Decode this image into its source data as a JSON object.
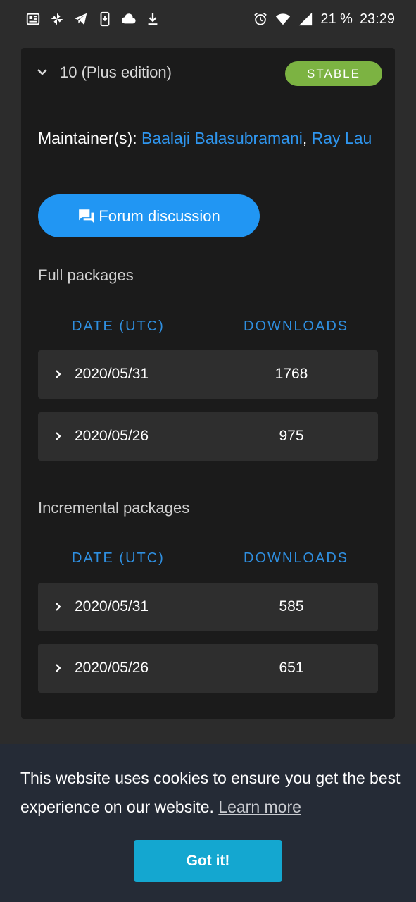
{
  "status_bar": {
    "left_icons": [
      "news-icon",
      "pinwheel-icon",
      "telegram-icon",
      "phone-download-icon",
      "cloud-icon",
      "download-icon"
    ],
    "right_icons": [
      "alarm-icon",
      "wifi-icon",
      "signal-icon"
    ],
    "battery": "21 %",
    "time": "23:29"
  },
  "release": {
    "version": "10 (Plus edition)",
    "badge": "STABLE",
    "badge_color": "#7cb342",
    "maintainers_label": "Maintainer(s):",
    "maintainers": [
      "Baalaji Balasubramani",
      "Ray Lau"
    ],
    "maintainer_separator": ",",
    "forum_button": "Forum discussion",
    "accent_color": "#2196f3"
  },
  "full_packages": {
    "title": "Full packages",
    "col_date": "DATE (UTC)",
    "col_downloads": "DOWNLOADS",
    "rows": [
      {
        "date": "2020/05/31",
        "downloads": "1768"
      },
      {
        "date": "2020/05/26",
        "downloads": "975"
      }
    ]
  },
  "incremental_packages": {
    "title": "Incremental packages",
    "col_date": "DATE (UTC)",
    "col_downloads": "DOWNLOADS",
    "rows": [
      {
        "date": "2020/05/31",
        "downloads": "585"
      },
      {
        "date": "2020/05/26",
        "downloads": "651"
      }
    ]
  },
  "cookie_banner": {
    "message": "This website uses cookies to ensure you get the best experience on our website.",
    "learn_more": "Learn more",
    "button": "Got it!",
    "button_color": "#14a7d0"
  }
}
